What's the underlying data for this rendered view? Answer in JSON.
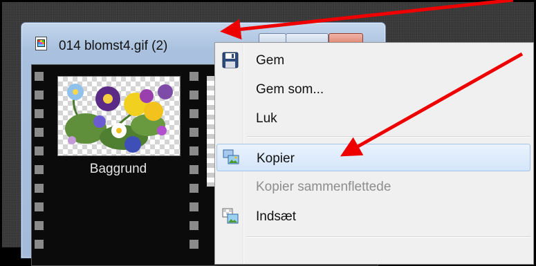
{
  "window": {
    "title": "014 blomst4.gif (2)",
    "icons": {
      "title": "image-file-icon"
    }
  },
  "layers": [
    {
      "label": "Baggrund"
    }
  ],
  "context_menu": {
    "items": [
      {
        "label": "Gem",
        "icon": "floppy-disk-icon",
        "enabled": true
      },
      {
        "label": "Gem som...",
        "enabled": true
      },
      {
        "label": "Luk",
        "enabled": true
      },
      {
        "label": "Kopier",
        "icon": "copy-image-icon",
        "enabled": true,
        "highlighted": true
      },
      {
        "label": "Kopier sammenflettede",
        "enabled": false
      },
      {
        "label": "Indsæt",
        "icon": "paste-image-icon",
        "enabled": true
      }
    ]
  },
  "colors": {
    "annotation_arrow": "#ee0000",
    "highlight": "#d4e6fb",
    "window_chrome": "#b5cae4"
  }
}
